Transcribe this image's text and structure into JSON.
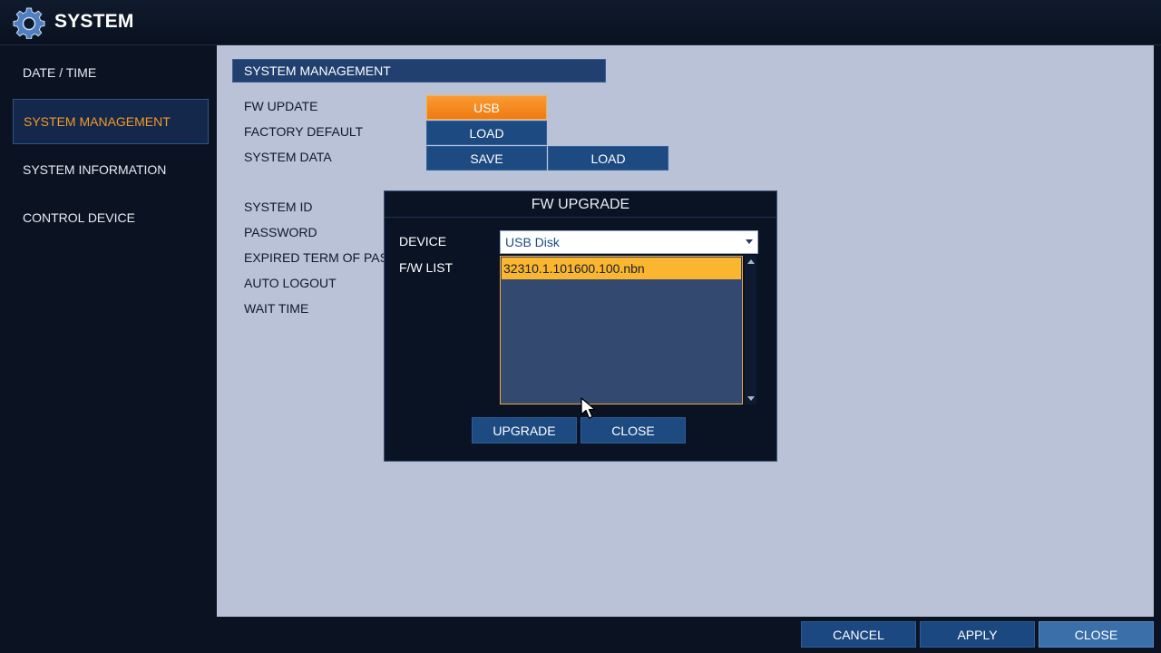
{
  "window": {
    "title": "SYSTEM",
    "icon": "gear-icon"
  },
  "sidebar": {
    "items": [
      {
        "label": "DATE / TIME",
        "active": false
      },
      {
        "label": "SYSTEM MANAGEMENT",
        "active": true
      },
      {
        "label": "SYSTEM INFORMATION",
        "active": false
      },
      {
        "label": "CONTROL DEVICE",
        "active": false
      }
    ]
  },
  "main": {
    "section_title": "SYSTEM MANAGEMENT",
    "fw_update": {
      "label": "FW UPDATE",
      "button": "USB"
    },
    "factory_default": {
      "label": "FACTORY DEFAULT",
      "button": "LOAD"
    },
    "system_data": {
      "label": "SYSTEM DATA",
      "save_button": "SAVE",
      "load_button": "LOAD"
    },
    "fields": {
      "system_id": "SYSTEM ID",
      "password": "PASSWORD",
      "expired_term": "EXPIRED TERM OF PASS",
      "auto_logout": "AUTO LOGOUT",
      "wait_time": "WAIT TIME"
    }
  },
  "dialog": {
    "title": "FW UPGRADE",
    "device_label": "DEVICE",
    "device_value": "USB Disk",
    "fw_list_label": "F/W LIST",
    "fw_list": [
      "32310.1.101600.100.nbn"
    ],
    "upgrade_button": "UPGRADE",
    "close_button": "CLOSE"
  },
  "footer": {
    "cancel": "CANCEL",
    "apply": "APPLY",
    "close": "CLOSE"
  },
  "colors": {
    "accent_orange": "#f39a2a",
    "button_blue": "#1e4a82",
    "content_bg": "#b9c2d7",
    "dark_bg": "#0b1322"
  }
}
